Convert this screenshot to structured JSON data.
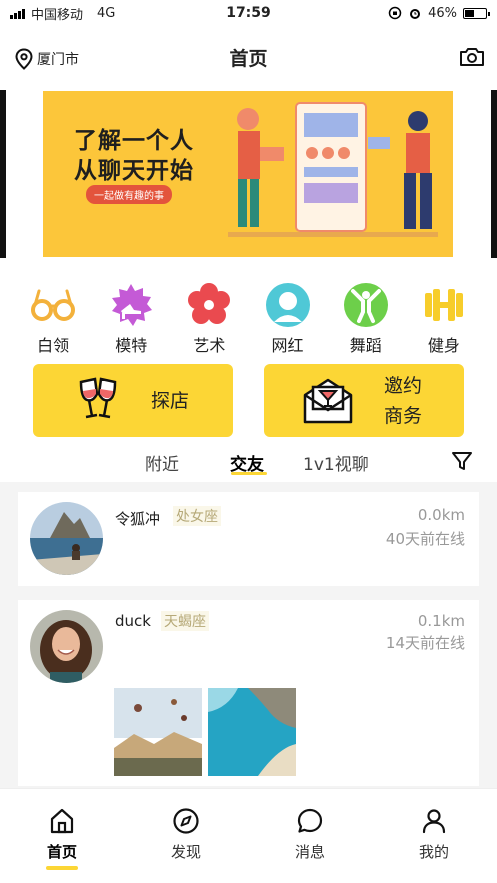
{
  "status_bar": {
    "carrier": "中国移动",
    "network": "4G",
    "time": "17:59",
    "battery": "46%",
    "battery_level": 0.46
  },
  "header": {
    "location": "厦门市",
    "title": "首页"
  },
  "banner": {
    "headline_1": "了解一个人",
    "headline_2": "从聊天开始",
    "tagline": "一起做有趣的事"
  },
  "categories": [
    {
      "label": "白领",
      "icon": "glasses-icon"
    },
    {
      "label": "模特",
      "icon": "high-heel-icon"
    },
    {
      "label": "艺术",
      "icon": "flower-icon"
    },
    {
      "label": "网红",
      "icon": "person-icon"
    },
    {
      "label": "舞蹈",
      "icon": "dancer-icon"
    },
    {
      "label": "健身",
      "icon": "dumbbell-icon"
    }
  ],
  "actions": {
    "explore": "探店",
    "invite_line_1": "邀约",
    "invite_line_2": "商务"
  },
  "tabs": {
    "nearby": "附近",
    "friends": "交友",
    "video": "1v1视聊"
  },
  "users": [
    {
      "name": "令狐冲",
      "zodiac": "处女座",
      "distance": "0.0km",
      "online": "40天前在线"
    },
    {
      "name": "duck",
      "zodiac": "天蝎座",
      "distance": "0.1km",
      "online": "14天前在线"
    }
  ],
  "nav": {
    "home": "首页",
    "discover": "发现",
    "messages": "消息",
    "mine": "我的"
  },
  "colors": {
    "accent": "#fcd635",
    "banner": "#fcc63a",
    "muted": "#999999"
  }
}
